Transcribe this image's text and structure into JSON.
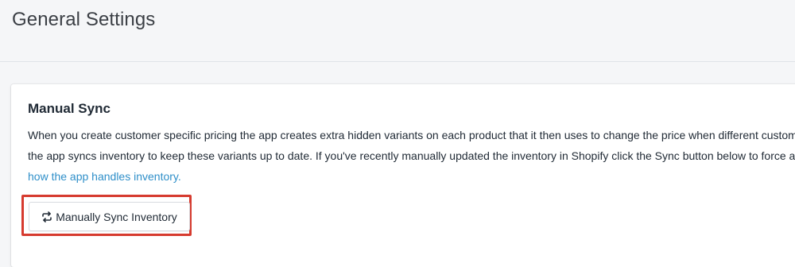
{
  "header": {
    "title": "General Settings"
  },
  "manual_sync": {
    "title": "Manual Sync",
    "description_lines": [
      "When you create customer specific pricing the app creates extra hidden variants on each product that it then uses to change the price when different custom",
      "the app syncs inventory to keep these variants up to date. If you've recently manually updated the inventory in Shopify click the Sync button below to force a"
    ],
    "link_text": "how the app handles inventory.",
    "button_label": "Manually Sync Inventory",
    "button_icon": "sync-icon"
  },
  "colors": {
    "link": "#2f8fc9",
    "highlight": "#d63b2f",
    "background": "#f5f6f8"
  }
}
